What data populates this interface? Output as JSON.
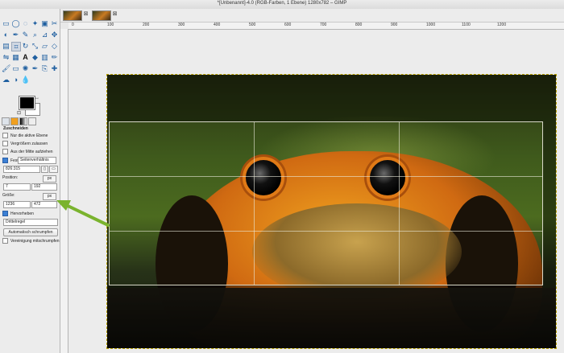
{
  "window": {
    "title": "*[Unbenannt]-4.0 (RGB-Farben, 1 Ebene) 1280x782 – GIMP"
  },
  "tabs": [
    {
      "name": "image-tab-1"
    },
    {
      "name": "image-tab-2"
    }
  ],
  "toolbox": {
    "tool_icons": [
      "rect-select-icon",
      "ellipse-select-icon",
      "free-select-icon",
      "fuzzy-select-icon",
      "color-select-icon",
      "scissors-icon",
      "foreground-select-icon",
      "paths-icon",
      "color-picker-icon",
      "zoom-icon",
      "measure-icon",
      "move-icon",
      "align-icon",
      "crop-icon",
      "rotate-icon",
      "scale-icon",
      "shear-icon",
      "perspective-icon",
      "flip-icon",
      "cage-icon",
      "text-icon",
      "bucket-fill-icon",
      "blend-icon",
      "pencil-icon",
      "paintbrush-icon",
      "eraser-icon",
      "airbrush-icon",
      "ink-icon",
      "clone-icon",
      "heal-icon",
      "smudge-icon",
      "dodge-icon",
      "blur-icon"
    ],
    "tool_glyphs": [
      "▭",
      "◯",
      "◌",
      "✦",
      "▣",
      "✂",
      "◐",
      "✒",
      "✎",
      "⌕",
      "⊿",
      "✥",
      "▤",
      "⌗",
      "↻",
      "⤡",
      "▱",
      "◇",
      "⇋",
      "▦",
      "A",
      "◆",
      "▥",
      "✏",
      "🖌",
      "▭",
      "✺",
      "✒",
      "⎘",
      "✚",
      "☁",
      "◑",
      "💧"
    ],
    "swatch_labels": {
      "swap": "↔",
      "reset": "⊡"
    }
  },
  "tool_options": {
    "title": "Zuschneiden",
    "only_active_layer": "Nur die aktive Ebene",
    "allow_grow": "Vergrößern zulassen",
    "from_center": "Aus der Mitte aufziehen",
    "fixed": "Fest",
    "fixed_mode": "Seitenverhältnis",
    "ratio_value": "826:315",
    "position_label": "Position:",
    "position_unit": "px",
    "position_x": "7",
    "position_y": "192",
    "size_label": "Größe:",
    "size_unit": "px",
    "size_w": "1236",
    "size_h": "472",
    "highlight": "Hervorheben",
    "guides_mode": "Drittelregel",
    "auto_shrink": "Automatisch schrumpfen",
    "merged": "Vereinigung mitschrumpfen"
  },
  "ruler": {
    "labels": [
      "0",
      "100",
      "200",
      "300",
      "400",
      "500",
      "600",
      "700",
      "800",
      "900",
      "1000",
      "1100",
      "1200"
    ]
  }
}
